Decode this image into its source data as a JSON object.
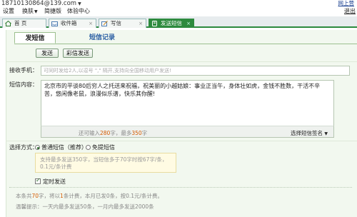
{
  "account": {
    "email": "18710130864@139.com",
    "online_help": "网上营",
    "logout": "退出"
  },
  "menu": [
    "设置",
    "换肤",
    "简捷版",
    "体验中心"
  ],
  "tabs": [
    {
      "label": "首 页"
    },
    {
      "label": "收件箱"
    },
    {
      "label": "写信"
    },
    {
      "label": "发送短信"
    }
  ],
  "subtabs": {
    "send": "发短信",
    "records": "短信记录"
  },
  "buttons": {
    "send": "发送",
    "mms": "彩信发送"
  },
  "form": {
    "recipient_label": "接收手机：",
    "recipient_placeholder": "可同时发给2人,以逗号 \",\" 隔开,支持向全国移动用户发送!",
    "content_label": "短信内容：",
    "content_text": "北京市的平谈80后穷人之托送来祝福，祝美丽的小越姑娘：事业正当午，身体壮如虎，金钱不胜数，干活不辛苦，悠闲像老鼠，浪漫似乐谱，快乐其你醒!",
    "count_pre": "还可输入",
    "count_num": "280",
    "count_mid": "字，最多",
    "count_max": "350",
    "count_post": "字",
    "signature": "选择短信签名",
    "mode_label": "选择方式：",
    "mode_normal": "普通短信（推荐）",
    "mode_free": "免提短信",
    "mode_note": "支持最多发送350字，当短信多于70字时按67字/条，0.1元/条计费",
    "scheduled": "定时发送"
  },
  "footer": {
    "line1_a": "本条共",
    "line1_num1": "70",
    "line1_b": "字，将以",
    "line1_num2": "1",
    "line1_c": "条计费，本月已发0条，按0.1元/条计费。",
    "line2": "温馨提示：一天内最多发送50条，一月内最多发送2000条"
  },
  "colors": {
    "accent": "#2d8a3e",
    "panel_bg": "#f2f8ef",
    "highlight": "#d45a00"
  }
}
